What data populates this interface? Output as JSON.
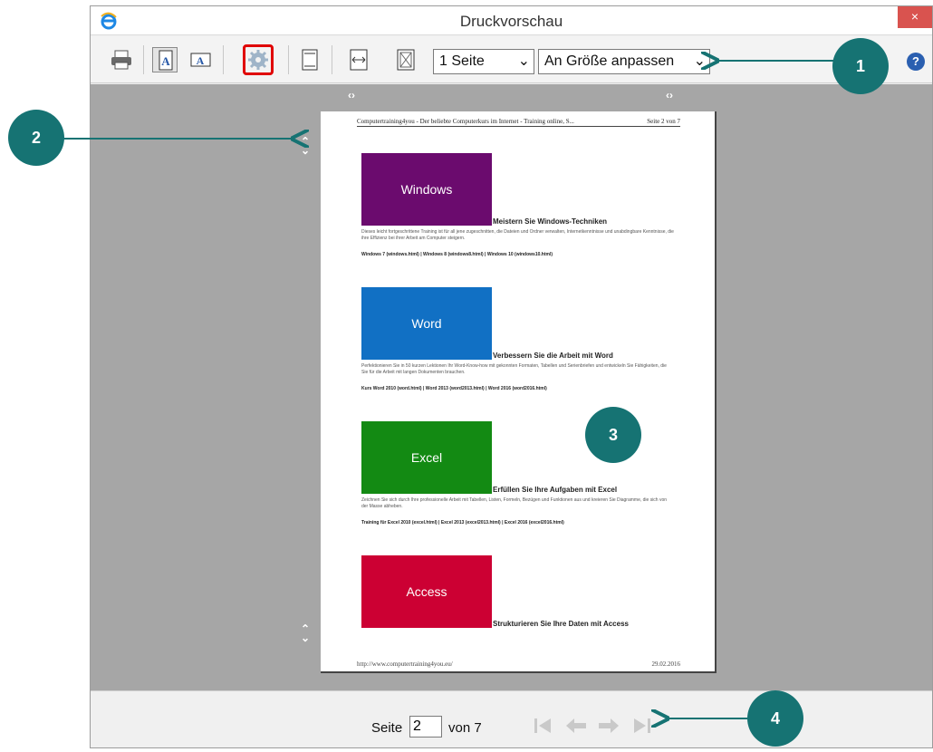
{
  "window": {
    "title": "Druckvorschau",
    "close_glyph": "×"
  },
  "toolbar": {
    "icons": [
      "printer-icon",
      "portrait-icon",
      "landscape-icon",
      "page-setup-gear-icon",
      "header-footer-icon",
      "fit-width-icon",
      "full-page-icon"
    ],
    "pages_select": "1 Seite",
    "zoom_select": "An Größe anpassen",
    "help_glyph": "?"
  },
  "preview": {
    "header_left": "Computertraining4you - Der beliebte Computerkurs im Internet - Training online, S...",
    "header_right": "Seite 2 von 7",
    "sections": [
      {
        "tile": "Windows",
        "color": "#6b0b6e",
        "title": "Meistern Sie Windows-Techniken",
        "text": "Dieses leicht fortgeschrittene Training ist für all jene zugeschnitten, die Dateien und Ordner verwalten, Internetkenntnisse und unabdingbare Kenntnisse, die ihre Effizienz bei ihrer Arbeit am Computer steigern.",
        "links": "Windows 7 (windows.html) | Windows 8 (windows8.html) | Windows 10 (windows10.html)"
      },
      {
        "tile": "Word",
        "color": "#1170c4",
        "title": "Verbessern Sie die Arbeit mit Word",
        "text": "Perfektionieren Sie in 50 kurzen Lektionen Ihr Word-Know-how mit gekonnten Formaten, Tabellen und Serienbriefen und entwickeln Sie Fähigkeiten, die Sie für die Arbeit mit langen Dokumenten brauchen.",
        "links": "Kurs Word 2010 (word.html) | Word 2013 (word2013.html) | Word 2016 (word2016.html)"
      },
      {
        "tile": "Excel",
        "color": "#138a13",
        "title": "Erfüllen Sie Ihre Aufgaben mit Excel",
        "text": "Zeichnen Sie sich durch Ihre professionelle Arbeit mit Tabellen, Listen, Formeln, Bezügen und Funktionen aus und kreieren Sie Diagramme, die sich von der Masse abheben.",
        "links": "Training für Excel 2010 (excel.html) | Excel 2013 (excel2013.html) | Excel 2016 (excel2016.html)"
      },
      {
        "tile": "Access",
        "color": "#cc0033",
        "title": "Strukturieren Sie Ihre Daten mit Access",
        "text": "",
        "links": ""
      }
    ],
    "footer_left": "http://www.computertraining4you.eu/",
    "footer_right": "29.02.2016"
  },
  "statusbar": {
    "page_label": "Seite",
    "page_value": "2",
    "of_label": "von 7"
  },
  "callouts": [
    "1",
    "2",
    "3",
    "4"
  ],
  "colors": {
    "callout": "#167373",
    "highlight": "#e00000"
  }
}
